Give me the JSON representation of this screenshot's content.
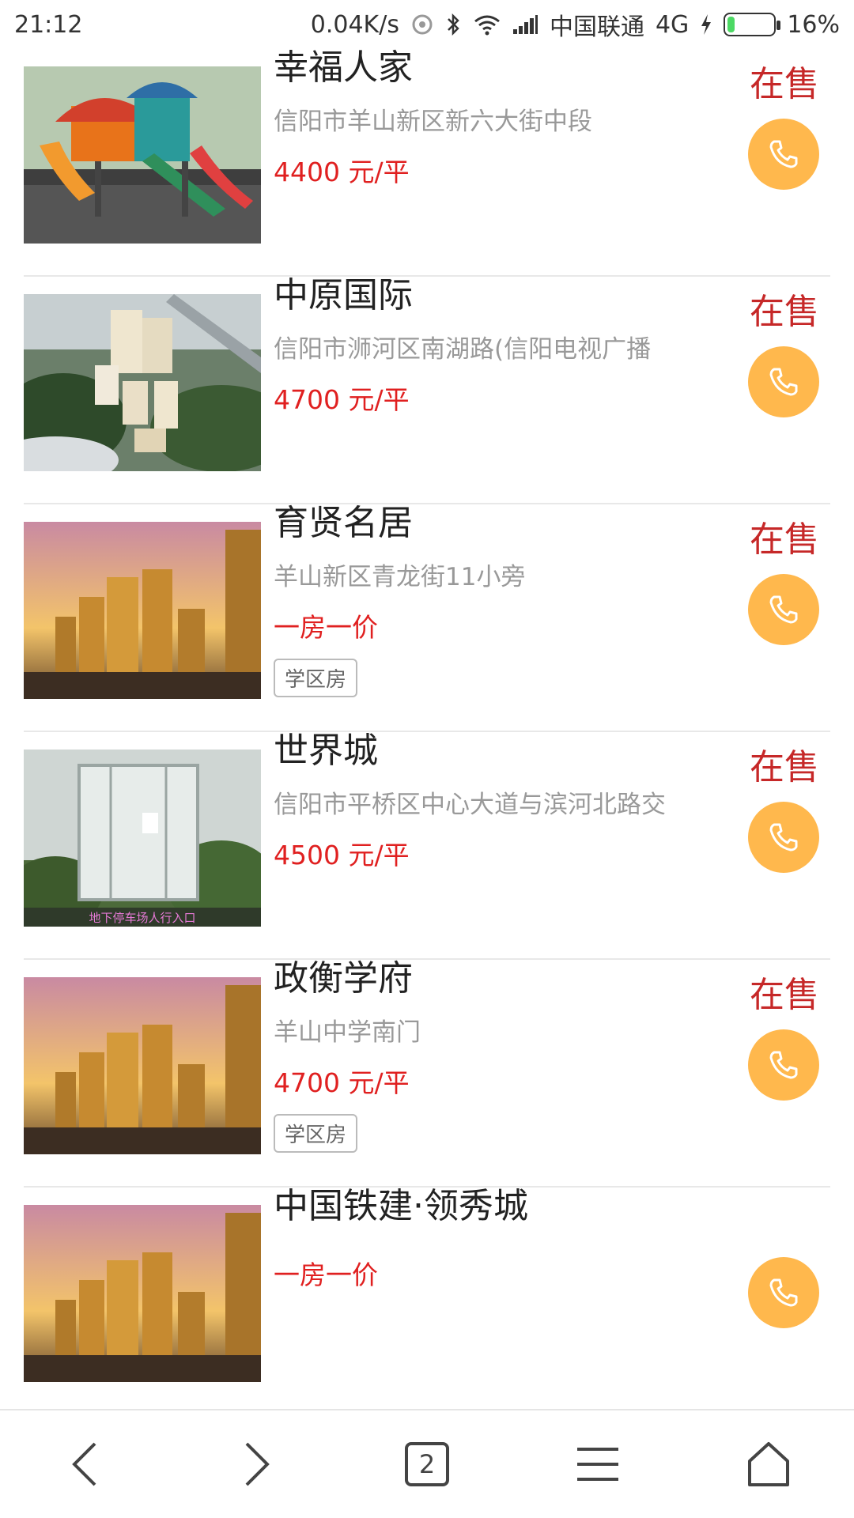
{
  "status_bar": {
    "time": "21:12",
    "net_speed": "0.04K/s",
    "carrier": "中国联通",
    "network": "4G",
    "battery": "16%",
    "battery_level": 0.16
  },
  "listings": [
    {
      "name": "幸福人家",
      "address": "信阳市羊山新区新六大街中段",
      "price": "4400 元/平",
      "tag": "",
      "status": "在售",
      "image": "playground-photo"
    },
    {
      "name": "中原国际",
      "address": "信阳市浉河区南湖路(信阳电视广播",
      "price": "4700 元/平",
      "tag": "",
      "status": "在售",
      "image": "aerial-complex-photo"
    },
    {
      "name": "育贤名居",
      "address": "羊山新区青龙街11小旁",
      "price": "一房一价",
      "tag": "学区房",
      "status": "在售",
      "image": "sunset-towers-photo"
    },
    {
      "name": "世界城",
      "address": "信阳市平桥区中心大道与滨河北路交",
      "price": "4500 元/平",
      "tag": "",
      "status": "在售",
      "image": "glass-entrance-photo",
      "image_caption": "地下停车场人行入口"
    },
    {
      "name": "政衡学府",
      "address": "羊山中学南门",
      "price": "4700 元/平",
      "tag": "学区房",
      "status": "在售",
      "image": "sunset-towers-photo"
    },
    {
      "name": "中国铁建·领秀城",
      "address": "",
      "price": "一房一价",
      "tag": "",
      "status": "",
      "image": "sunset-towers-photo"
    }
  ],
  "bottom_nav": {
    "tab_count": "2",
    "icons": [
      "back-arrow-icon",
      "forward-arrow-icon",
      "tabs-icon",
      "menu-icon",
      "home-icon"
    ]
  },
  "colors": {
    "price": "#e02020",
    "status": "#c62828",
    "call_button": "#ffb84d"
  }
}
